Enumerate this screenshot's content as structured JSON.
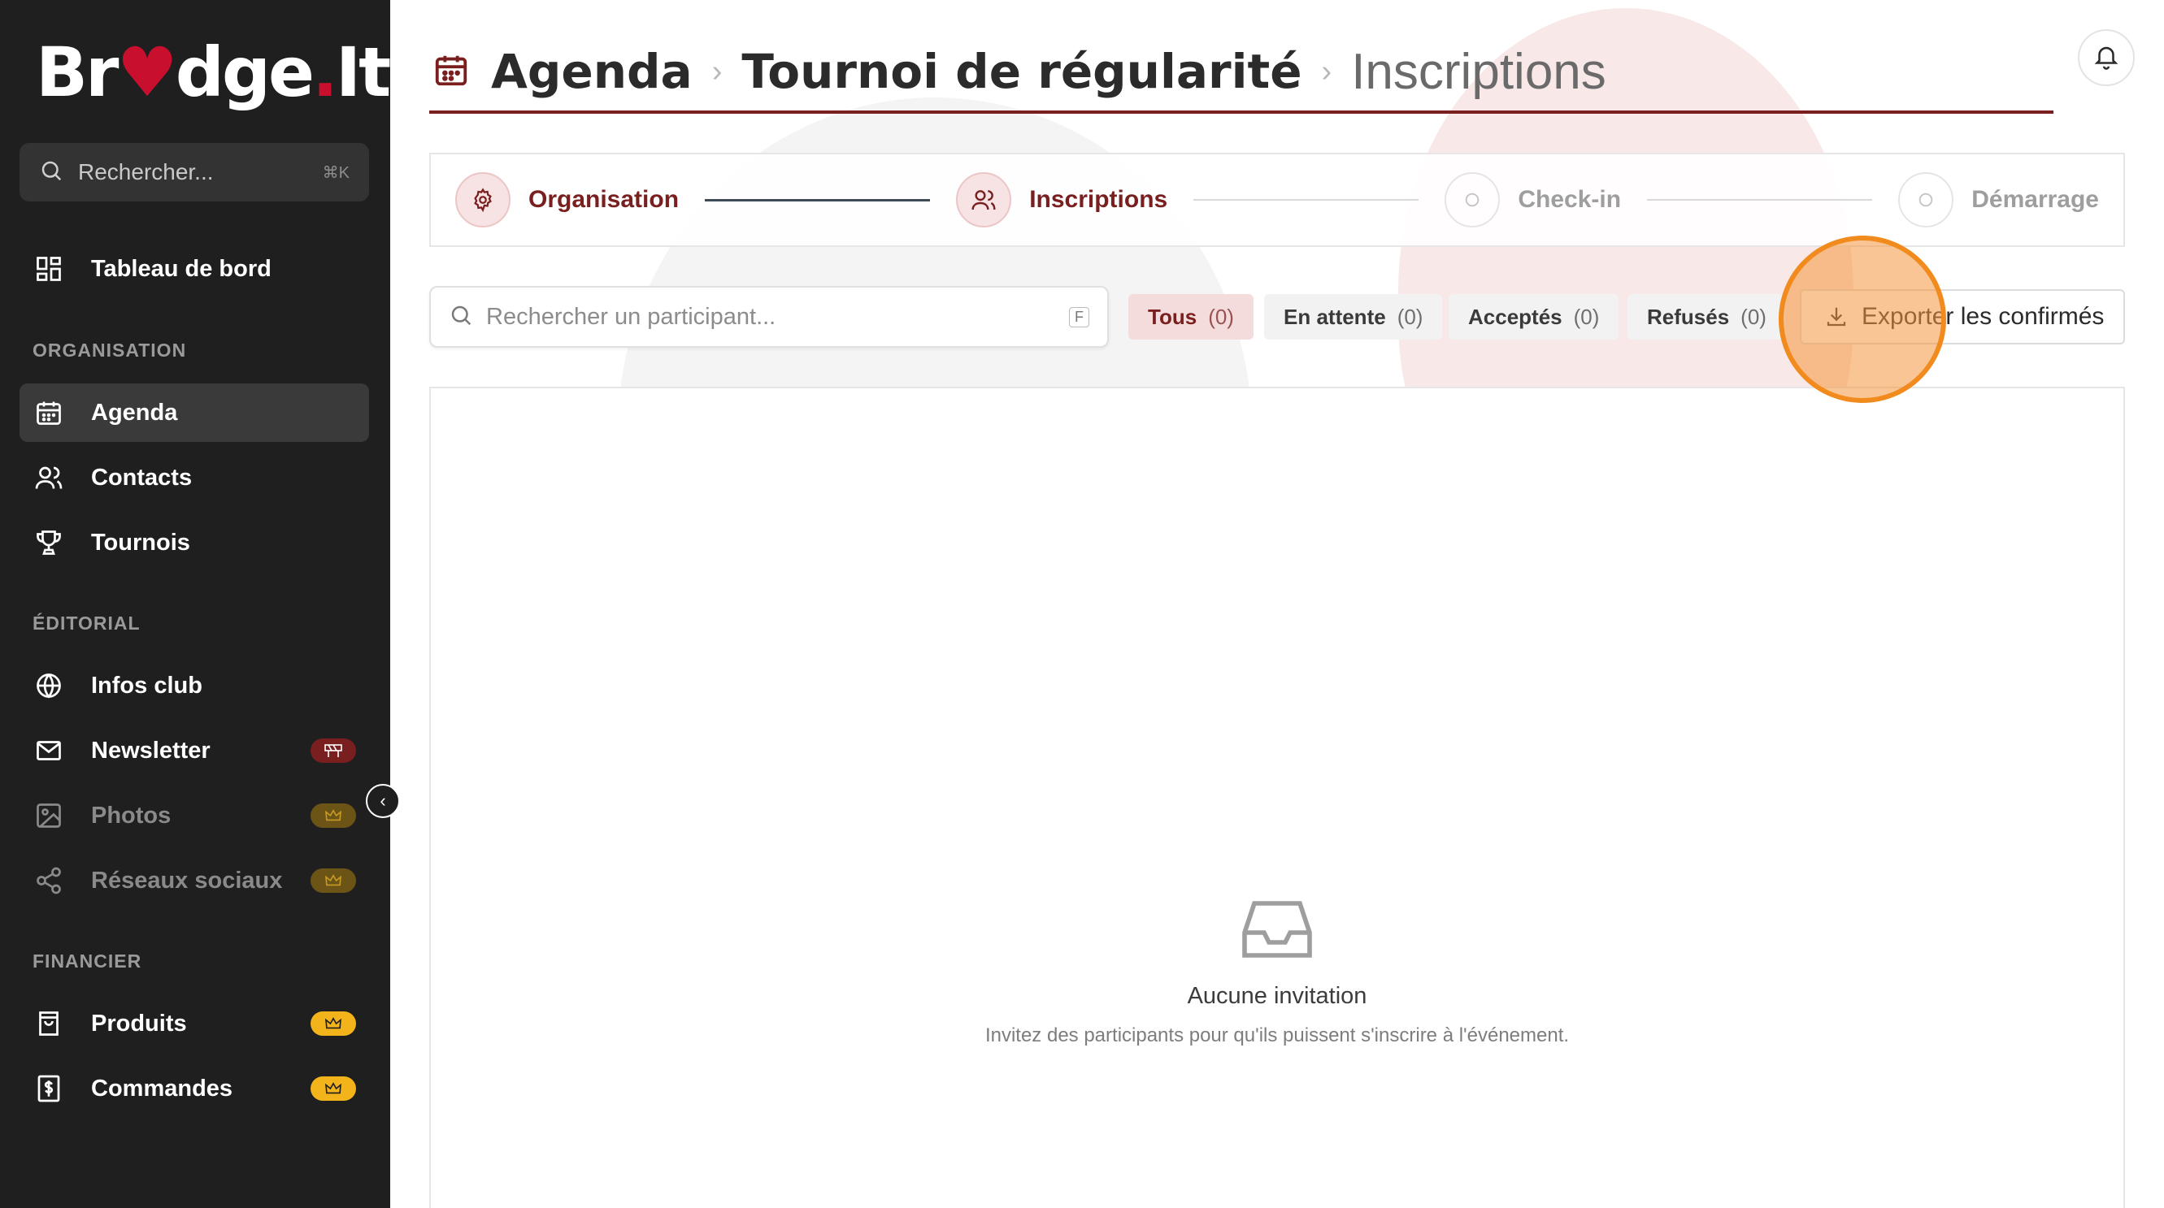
{
  "brand": {
    "name_part1": "Br",
    "name_part2": "dge",
    "name_part3": "It",
    "heart": "♥",
    "dot": "."
  },
  "sidebar": {
    "search_placeholder": "Rechercher...",
    "search_shortcut": "⌘K",
    "dashboard": "Tableau de bord",
    "sections": {
      "organisation": "ORGANISATION",
      "editorial": "ÉDITORIAL",
      "financial": "FINANCIER"
    },
    "items": {
      "agenda": "Agenda",
      "contacts": "Contacts",
      "tournois": "Tournois",
      "infos_club": "Infos club",
      "newsletter": "Newsletter",
      "photos": "Photos",
      "reseaux": "Réseaux sociaux",
      "produits": "Produits",
      "commandes": "Commandes"
    }
  },
  "header": {
    "crumb1": "Agenda",
    "crumb2": "Tournoi de régularité",
    "crumb3": "Inscriptions",
    "separator": "›"
  },
  "stepper": {
    "step1": "Organisation",
    "step2": "Inscriptions",
    "step3": "Check-in",
    "step4": "Démarrage"
  },
  "filters": {
    "search_placeholder": "Rechercher un participant...",
    "search_shortcut": "F",
    "all": {
      "label": "Tous",
      "count": "(0)"
    },
    "pending": {
      "label": "En attente",
      "count": "(0)"
    },
    "accepted": {
      "label": "Acceptés",
      "count": "(0)"
    },
    "refused": {
      "label": "Refusés",
      "count": "(0)"
    },
    "export_label": "Exporter les confirmés"
  },
  "empty_state": {
    "title": "Aucune invitation",
    "description": "Invitez des participants pour qu'ils puissent s'inscrire à l'événement."
  },
  "colors": {
    "brand_red": "#7a1f1f",
    "sidebar_bg": "#1f1f1f",
    "premium_badge": "#f2b31b",
    "highlight": "#f28b1e"
  }
}
